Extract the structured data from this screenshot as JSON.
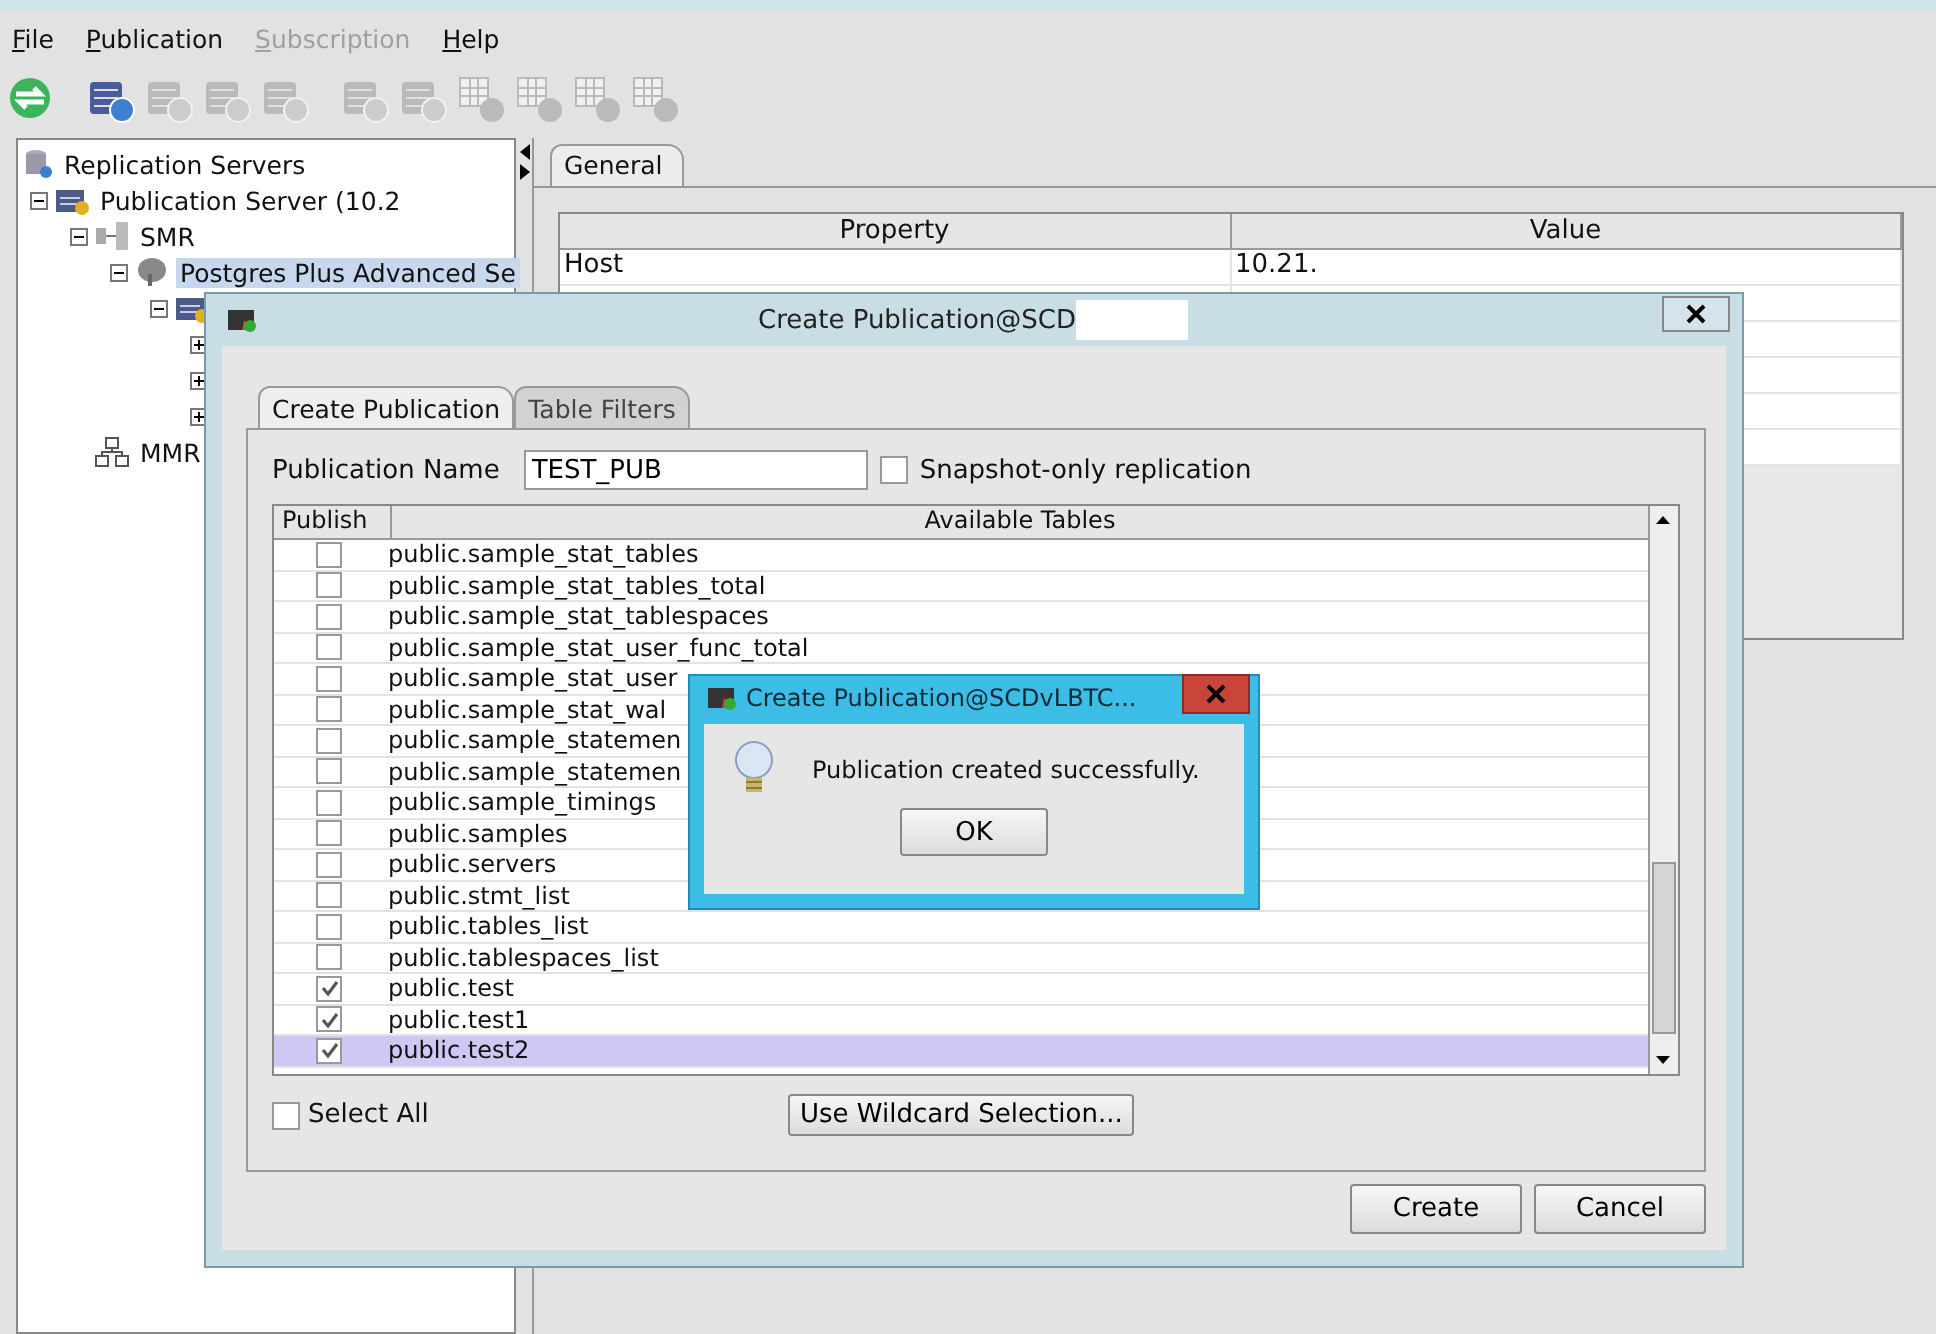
{
  "menu": [
    {
      "label": "File",
      "disabled": false
    },
    {
      "label": "Publication",
      "disabled": false
    },
    {
      "label": "Subscription",
      "disabled": true
    },
    {
      "label": "Help",
      "disabled": false
    }
  ],
  "toolbar": [
    {
      "kind": "refresh",
      "disabled": false
    },
    {
      "kind": "server-add",
      "disabled": false
    },
    {
      "kind": "server-remove",
      "disabled": true
    },
    {
      "kind": "server-edit",
      "disabled": true
    },
    {
      "kind": "server-link",
      "disabled": true
    },
    {
      "kind": "db-add",
      "disabled": true
    },
    {
      "kind": "db-remove",
      "disabled": true
    },
    {
      "kind": "grid-connect",
      "disabled": true
    },
    {
      "kind": "grid-link",
      "disabled": true
    },
    {
      "kind": "grid-add",
      "disabled": true
    },
    {
      "kind": "grid-remove",
      "disabled": true
    }
  ],
  "tree": [
    {
      "label": "Replication Servers",
      "kind": "root",
      "selected": false,
      "children": [
        {
          "label": "Publication Server (10.2",
          "kind": "server",
          "expanded": true,
          "selected": false,
          "children": [
            {
              "label": "SMR",
              "kind": "smr",
              "expanded": true,
              "selected": false,
              "children": [
                {
                  "label": "Postgres Plus Advanced Se",
                  "kind": "postgres",
                  "expanded": true,
                  "selected": true,
                  "children": [
                    {
                      "kind": "db",
                      "expanded": true,
                      "children": [
                        {
                          "expanded": false
                        },
                        {
                          "expanded": false
                        },
                        {
                          "expanded": false
                        }
                      ]
                    }
                  ]
                }
              ]
            },
            {
              "label": "MMR",
              "kind": "mmr",
              "selected": false
            }
          ]
        }
      ]
    }
  ],
  "details": {
    "tabs": [
      {
        "label": "General",
        "selected": true
      }
    ],
    "columns": [
      "Property",
      "Value"
    ],
    "rows": [
      [
        "Host",
        "10.21."
      ]
    ]
  },
  "dialog": {
    "title": "Create Publication@SCD",
    "tabs": [
      {
        "label": "Create Publication",
        "selected": true
      },
      {
        "label": "Table Filters",
        "selected": false
      }
    ],
    "name_label": "Publication Name",
    "name_value": "TEST_PUB",
    "snapshot": {
      "label": "Snapshot-only replication",
      "checked": false
    },
    "columns": [
      "Publish",
      "Available Tables"
    ],
    "rows": [
      {
        "name": "public.sample_stat_tables",
        "checked": false,
        "selected": false
      },
      {
        "name": "public.sample_stat_tables_total",
        "checked": false,
        "selected": false
      },
      {
        "name": "public.sample_stat_tablespaces",
        "checked": false,
        "selected": false
      },
      {
        "name": "public.sample_stat_user_func_total",
        "checked": false,
        "selected": false
      },
      {
        "name": "public.sample_stat_user",
        "checked": false,
        "selected": false
      },
      {
        "name": "public.sample_stat_wal",
        "checked": false,
        "selected": false
      },
      {
        "name": "public.sample_statemen",
        "checked": false,
        "selected": false
      },
      {
        "name": "public.sample_statemen",
        "checked": false,
        "selected": false
      },
      {
        "name": "public.sample_timings",
        "checked": false,
        "selected": false
      },
      {
        "name": "public.samples",
        "checked": false,
        "selected": false
      },
      {
        "name": "public.servers",
        "checked": false,
        "selected": false
      },
      {
        "name": "public.stmt_list",
        "checked": false,
        "selected": false
      },
      {
        "name": "public.tables_list",
        "checked": false,
        "selected": false
      },
      {
        "name": "public.tablespaces_list",
        "checked": false,
        "selected": false
      },
      {
        "name": "public.test",
        "checked": true,
        "selected": false
      },
      {
        "name": "public.test1",
        "checked": true,
        "selected": false
      },
      {
        "name": "public.test2",
        "checked": true,
        "selected": true
      }
    ],
    "select_all": {
      "label": "Select All",
      "checked": false
    },
    "wildcard_button": "Use Wildcard Selection...",
    "buttons": [
      "Create",
      "Cancel"
    ]
  },
  "message": {
    "title": "Create Publication@SCDvLBTC...",
    "text": "Publication created successfully.",
    "button": "OK"
  }
}
